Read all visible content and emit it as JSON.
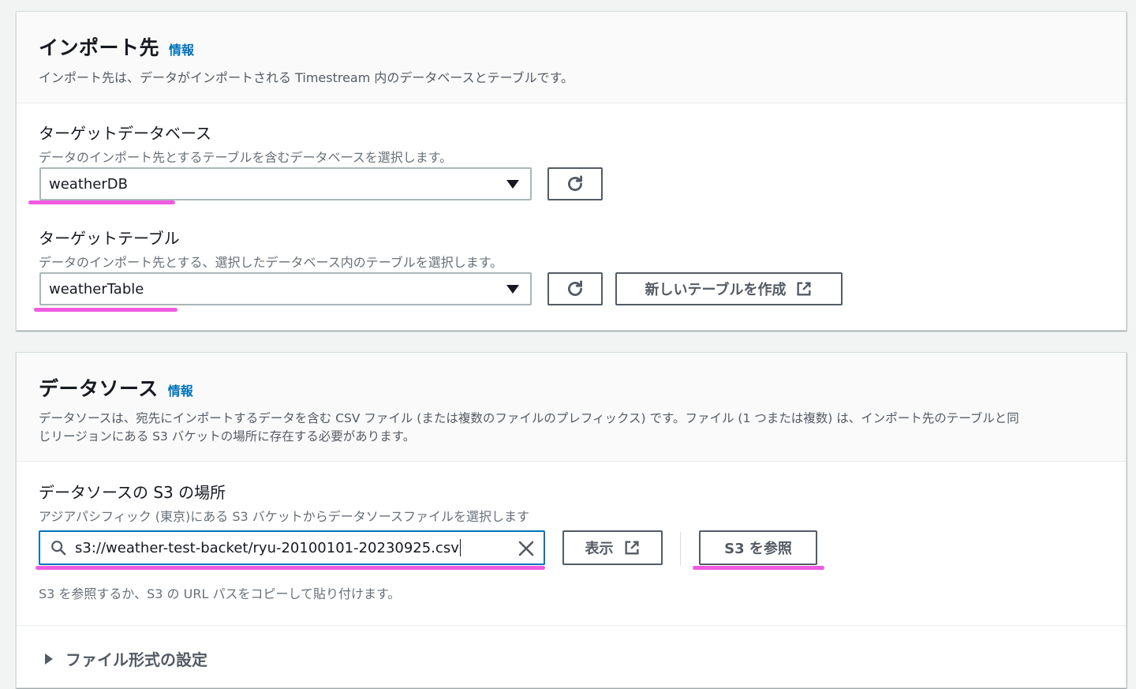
{
  "import_target": {
    "title": "インポート先",
    "info": "情報",
    "description": "インポート先は、データがインポートされる Timestream 内のデータベースとテーブルです。",
    "database": {
      "label": "ターゲットデータベース",
      "description": "データのインポート先とするテーブルを含むデータベースを選択します。",
      "value": "weatherDB"
    },
    "table": {
      "label": "ターゲットテーブル",
      "description": "データのインポート先とする、選択したデータベース内のテーブルを選択します。",
      "value": "weatherTable",
      "create_button": "新しいテーブルを作成"
    }
  },
  "data_source": {
    "title": "データソース",
    "info": "情報",
    "description_line1": "データソースは、宛先にインポートするデータを含む CSV ファイル (または複数のファイルのプレフィックス) です。ファイル (1 つまたは複数) は、インポート先のテーブルと同",
    "description_line2": "じリージョンにある S3 バケットの場所に存在する必要があります。",
    "s3_location": {
      "label": "データソースの S3 の場所",
      "description": "アジアパシフィック (東京)にある S3 バケットからデータソースファイルを選択します",
      "value": "s3://weather-test-backet/ryu-20100101-20230925.csv",
      "view_button": "表示",
      "browse_button": "S3 を参照",
      "hint": "S3 を参照するか、S3 の URL パスをコピーして貼り付けます。"
    },
    "file_format": {
      "label": "ファイル形式の設定"
    }
  },
  "colors": {
    "highlight": "#f05be0",
    "link": "#0073bb",
    "focus": "#0073bb"
  }
}
